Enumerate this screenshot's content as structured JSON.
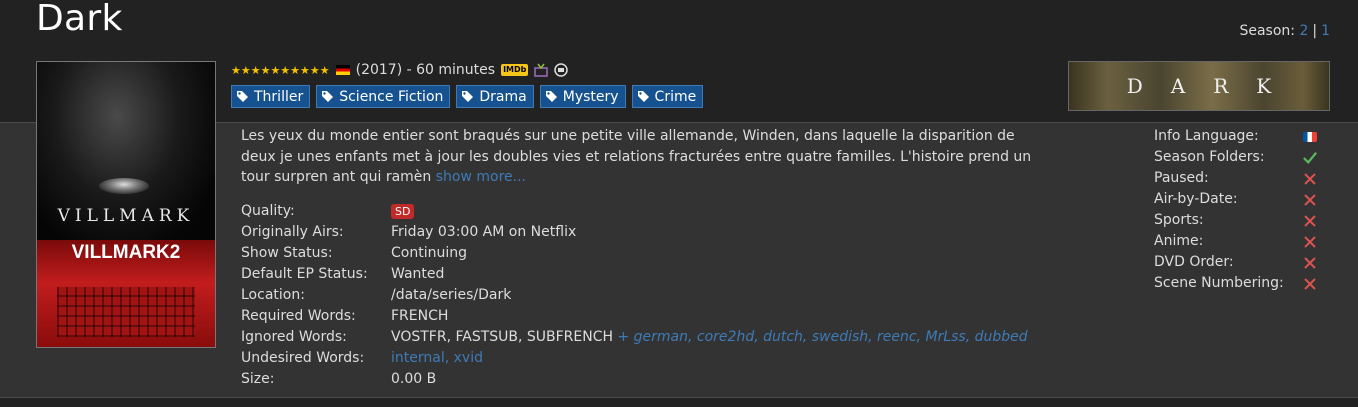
{
  "show": {
    "title": "Dark",
    "rating_stars": "★★★★★★★★★★",
    "year_runtime": "(2017) - 60 minutes",
    "imdb_label": "IMDb"
  },
  "season_nav": {
    "label": "Season:",
    "seasons": [
      "2",
      "1"
    ]
  },
  "genres": [
    "Thriller",
    "Science Fiction",
    "Drama",
    "Mystery",
    "Crime"
  ],
  "poster": {
    "line1": "VILLMARK",
    "line2": "VILLMARK2"
  },
  "banner": {
    "text": "DARK"
  },
  "description": {
    "text": "Les yeux du monde entier sont braqués sur une petite ville allemande, Winden, dans laquelle la disparition de deux je unes enfants met à jour les doubles vies et relations fracturées entre quatre familles. L'histoire prend un tour surpren ant qui ramèn",
    "show_more": "show more..."
  },
  "details": {
    "quality_label": "Quality:",
    "quality_value": "SD",
    "airs_label": "Originally Airs:",
    "airs_value": "Friday 03:00 AM on Netflix",
    "status_label": "Show Status:",
    "status_value": "Continuing",
    "ep_status_label": "Default EP Status:",
    "ep_status_value": "Wanted",
    "location_label": "Location:",
    "location_value": "/data/series/Dark",
    "required_label": "Required Words:",
    "required_value": "FRENCH",
    "ignored_label": "Ignored Words:",
    "ignored_value": "VOSTFR, FASTSUB, SUBFRENCH",
    "ignored_extra": "+ german, core2hd, dutch, swedish, reenc, MrLss, dubbed",
    "undesired_label": "Undesired Words:",
    "undesired_value": "internal, xvid",
    "size_label": "Size:",
    "size_value": "0.00 B"
  },
  "settings": {
    "info_language": "Info Language:",
    "season_folders": "Season Folders:",
    "paused": "Paused:",
    "air_by_date": "Air-by-Date:",
    "sports": "Sports:",
    "anime": "Anime:",
    "dvd_order": "DVD Order:",
    "scene_numbering": "Scene Numbering:"
  },
  "colors": {
    "accent": "#3e7bb6",
    "genre_bg": "#15528f",
    "check": "#5cb85c",
    "cross": "#d9534f"
  }
}
